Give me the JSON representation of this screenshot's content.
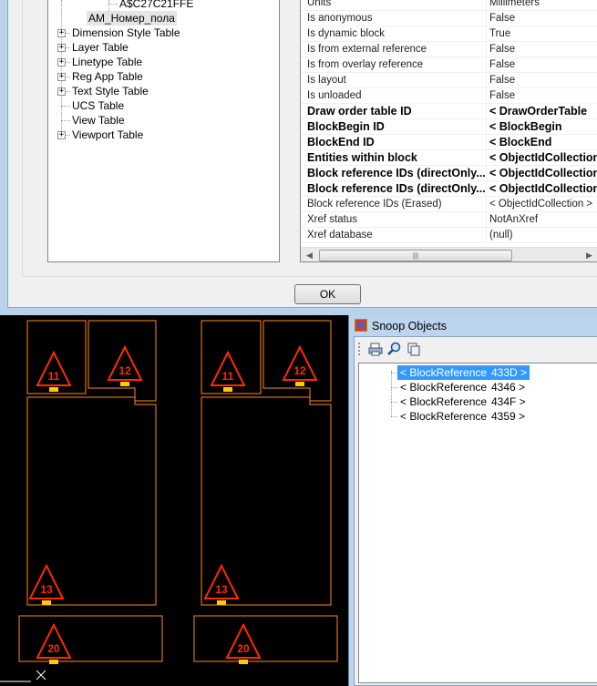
{
  "tree": {
    "partial_top_item": "A$C27C21FFE",
    "selected_item": "AM_Номер_пола",
    "items": [
      {
        "label": "Dimension Style Table",
        "expandable": true
      },
      {
        "label": "Layer Table",
        "expandable": true
      },
      {
        "label": "Linetype Table",
        "expandable": true
      },
      {
        "label": "Reg App Table",
        "expandable": true
      },
      {
        "label": "Text Style Table",
        "expandable": true
      },
      {
        "label": "UCS Table",
        "expandable": false
      },
      {
        "label": "View Table",
        "expandable": false
      },
      {
        "label": "Viewport Table",
        "expandable": true
      }
    ]
  },
  "grid": {
    "rows": [
      {
        "key": "Units",
        "value": "Millimeters",
        "bold": false
      },
      {
        "key": "Is anonymous",
        "value": "False",
        "bold": false
      },
      {
        "key": "Is dynamic block",
        "value": "True",
        "bold": false
      },
      {
        "key": "Is from external reference",
        "value": "False",
        "bold": false
      },
      {
        "key": "Is from overlay reference",
        "value": "False",
        "bold": false
      },
      {
        "key": "Is layout",
        "value": "False",
        "bold": false
      },
      {
        "key": "Is unloaded",
        "value": "False",
        "bold": false
      },
      {
        "key": "Draw order table ID",
        "value": "< DrawOrderTable",
        "bold": true
      },
      {
        "key": "BlockBegin ID",
        "value": "< BlockBegin",
        "bold": true
      },
      {
        "key": "BlockEnd ID",
        "value": "< BlockEnd",
        "bold": true
      },
      {
        "key": "Entities within block",
        "value": "< ObjectIdCollection",
        "bold": true
      },
      {
        "key": "Block reference IDs (directOnly...",
        "value": "< ObjectIdCollection",
        "bold": true
      },
      {
        "key": "Block reference IDs (directOnly...",
        "value": "< ObjectIdCollection",
        "bold": true
      },
      {
        "key": "Block reference IDs (Erased)",
        "value": "< ObjectIdCollection >",
        "bold": false
      },
      {
        "key": "Xref status",
        "value": "NotAnXref",
        "bold": false
      },
      {
        "key": "Xref database",
        "value": "(null)",
        "bold": false
      }
    ],
    "scroll_left_glyph": "◀",
    "scroll_right_glyph": "▶",
    "thumb_grip": "|||"
  },
  "dialog": {
    "ok_label": "OK"
  },
  "cad": {
    "room_numbers": [
      "11",
      "12",
      "13",
      "20"
    ],
    "colors": {
      "outline": "#ff8a1e",
      "triangle": "#ff2a00",
      "label": "#ff2a00",
      "tag": "#ffcc00",
      "background": "#000000"
    }
  },
  "snoop": {
    "title": "Snoop Objects",
    "toolbar_icons": [
      "print-icon",
      "find-icon",
      "copy-icon"
    ],
    "items": [
      {
        "type": "< BlockReference",
        "handle": "433D >",
        "selected": true
      },
      {
        "type": "< BlockReference",
        "handle": "4346 >",
        "selected": false
      },
      {
        "type": "< BlockReference",
        "handle": "434F >",
        "selected": false
      },
      {
        "type": "< BlockReference",
        "handle": "4359 >",
        "selected": false
      }
    ]
  },
  "colors": {
    "selection": "#3399ff",
    "window_frame": "#b9d1ea"
  }
}
